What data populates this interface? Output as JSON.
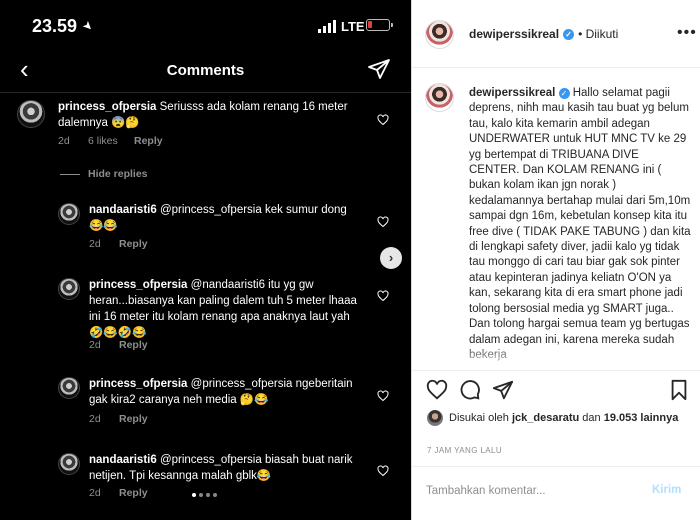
{
  "phone": {
    "time": "23.59",
    "network": "LTE",
    "battery_level": 0.2,
    "header_title": "Comments",
    "hide_replies": "Hide replies",
    "comments": [
      {
        "username": "princess_ofpersia",
        "text": "Seriusss ada kolam renang 16 meter dalemnya 😨🤔",
        "ago": "2d",
        "likes": "6 likes",
        "reply": "Reply"
      },
      {
        "username": "nandaaristi6",
        "text": "@princess_ofpersia kek sumur dong😂😂",
        "ago": "2d",
        "reply": "Reply"
      },
      {
        "username": "princess_ofpersia",
        "text": "@nandaaristi6 itu yg gw heran...biasanya kan paling dalem tuh 5 meter lhaaa ini 16 meter itu kolam renang apa anaknya laut yah 🤣😂🤣😂",
        "ago": "2d",
        "reply": "Reply"
      },
      {
        "username": "princess_ofpersia",
        "text": "@princess_ofpersia ngeberitain gak kira2 caranya neh media 🤔😂",
        "ago": "2d",
        "reply": "Reply"
      },
      {
        "username": "nandaaristi6",
        "text": "@princess_ofpersia biasah buat narik netijen. Tpi kesannga malah gblk😂",
        "ago": "2d",
        "reply": "Reply"
      }
    ],
    "carousel": {
      "total": 4,
      "active": 0
    }
  },
  "panel": {
    "username": "dewiperssikreal",
    "follow_status": "• Diikuti",
    "caption": "Hallo selamat pagii deprens, nihh mau kasih tau buat yg belum tau, kalo kita kemarin ambil adegan UNDERWATER untuk HUT MNC TV ke 29 yg bertempat di TRIBUANA DIVE CENTER. Dan KOLAM RENANG ini ( bukan kolam ikan jgn norak ) kedalamannya bertahap mulai dari 5m,10m sampai dgn 16m, kebetulan konsep kita itu free dive ( TIDAK PAKE TABUNG ) dan kita di lengkapi safety diver, jadii kalo yg tidak tau monggo di cari tau biar gak sok pinter atau kepinteran jadinya keliatn O'ON ya kan, sekarang kita di era smart phone jadi tolong bersosial media yg SMART juga.. Dan tolong hargai semua team yg bertugas dalam adegan ini, karena mereka sudah bekerja",
    "liked_prefix": "Disukai oleh ",
    "liked_user": "jck_desaratu",
    "liked_mid": " dan ",
    "liked_count": "19.053",
    "liked_suffix": " lainnya",
    "time_ago": "7 JAM YANG LALU",
    "comment_placeholder": "Tambahkan komentar...",
    "post_label": "Kirim"
  },
  "colors": {
    "verified": "#3897f0",
    "post_disabled": "#b2dffc",
    "battery_low": "#e0413f"
  }
}
